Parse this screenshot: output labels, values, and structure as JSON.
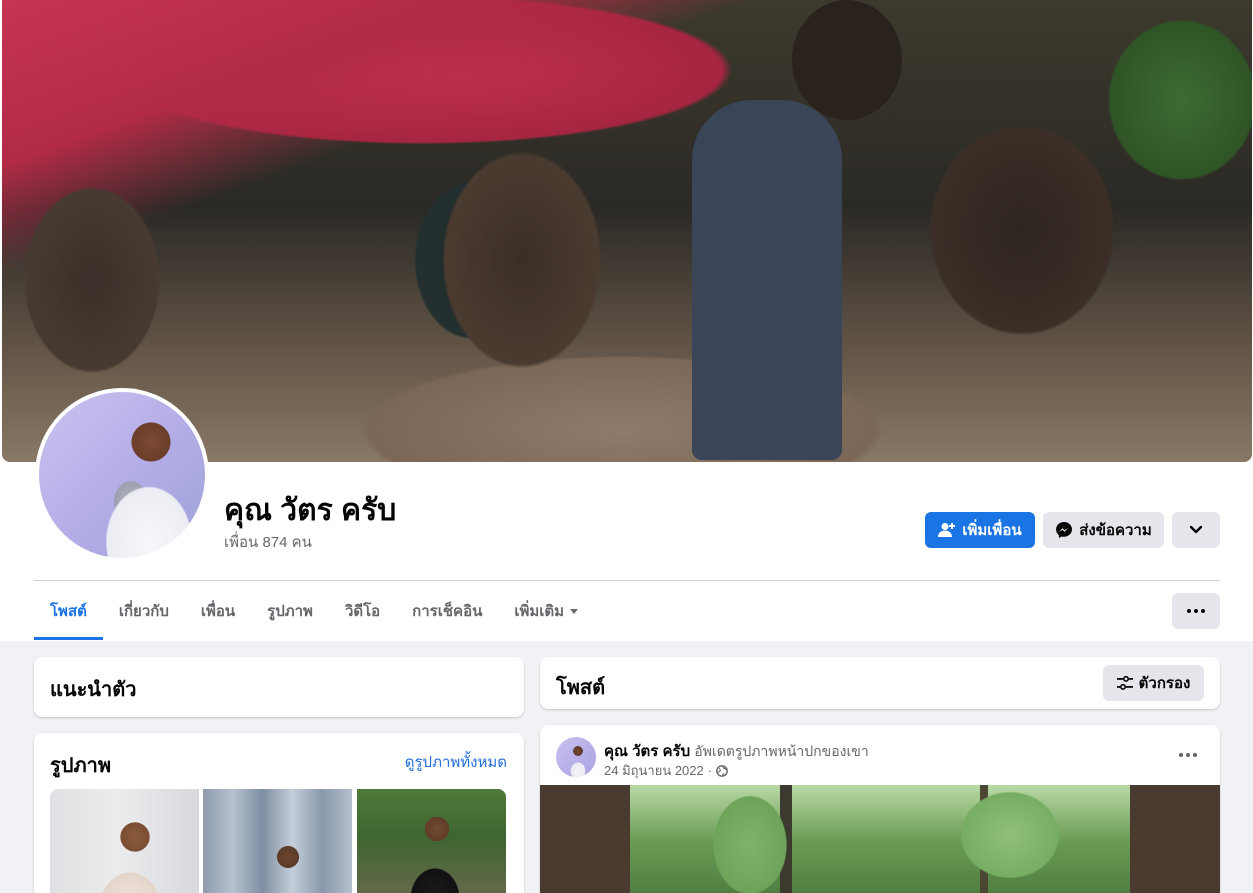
{
  "profile": {
    "name": "คุณ วัตร ครับ",
    "friends_text": "เพื่อน 874 คน"
  },
  "actions": {
    "add_friend": "เพิ่มเพื่อน",
    "message": "ส่งข้อความ"
  },
  "tabs": [
    {
      "label": "โพสต์",
      "active": true
    },
    {
      "label": "เกี่ยวกับ"
    },
    {
      "label": "เพื่อน"
    },
    {
      "label": "รูปภาพ"
    },
    {
      "label": "วิดีโอ"
    },
    {
      "label": "การเช็คอิน"
    },
    {
      "label": "เพิ่มเติม"
    }
  ],
  "intro": {
    "title": "แนะนำตัว"
  },
  "photos": {
    "title": "รูปภาพ",
    "see_all": "ดูรูปภาพทั้งหมด"
  },
  "posts": {
    "title": "โพสต์",
    "filter_label": "ตัวกรอง"
  },
  "post": {
    "author": "คุณ วัตร ครับ",
    "action": "อัพเดตรูปภาพหน้าปกของเขา",
    "date": "24 มิถุนายน 2022",
    "privacy_icon": "globe-icon"
  },
  "colors": {
    "accent": "#1b74e4",
    "link": "#216fdb",
    "background": "#f0f2f5",
    "button_gray": "#e4e6eb"
  }
}
